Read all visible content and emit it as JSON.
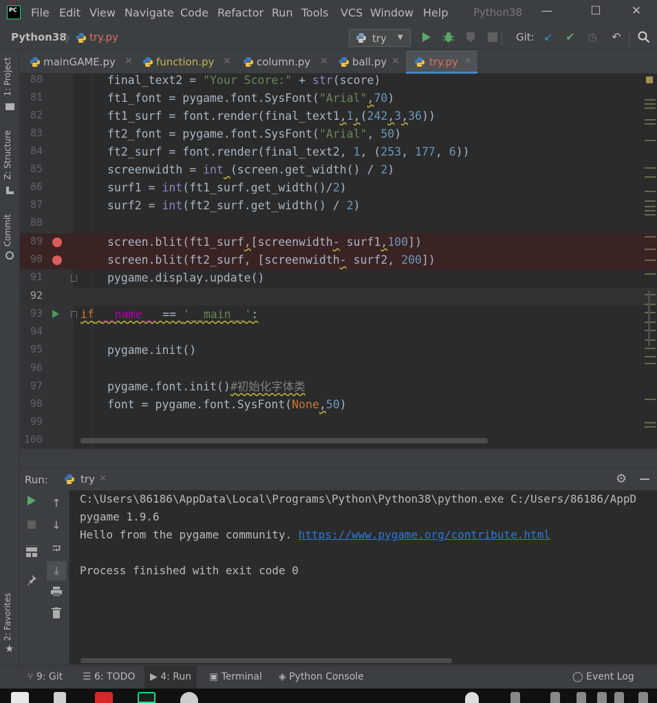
{
  "app": {
    "logo_text": "PC",
    "window_title": "Python38"
  },
  "menu": [
    "File",
    "Edit",
    "View",
    "Navigate",
    "Code",
    "Refactor",
    "Run",
    "Tools",
    "VCS",
    "Window",
    "Help"
  ],
  "window_controls": {
    "minimize": "—",
    "maximize": "☐",
    "close": "✕"
  },
  "navbar": {
    "project": "Python38",
    "separator": "〉",
    "file": "try.py",
    "run_config": "try",
    "git_label": "Git:"
  },
  "left_stripe": {
    "project": "1: Project",
    "structure": "Z: Structure",
    "commit": "Commit",
    "favorites": "2: Favorites"
  },
  "tabs": [
    {
      "label": "mainGAME.py",
      "active": false
    },
    {
      "label": "function.py",
      "active": false
    },
    {
      "label": "column.py",
      "active": false
    },
    {
      "label": "ball.py",
      "active": false
    },
    {
      "label": "try.py",
      "active": true
    }
  ],
  "editor": {
    "line_numbers": [
      "80",
      "81",
      "82",
      "83",
      "84",
      "85",
      "86",
      "87",
      "88",
      "89",
      "90",
      "91",
      "92",
      "93",
      "94",
      "95",
      "96",
      "97",
      "98",
      "99",
      "100"
    ],
    "breakpoint_lines": [
      "89",
      "90"
    ],
    "run_marker_line": "93"
  },
  "run": {
    "label": "Run:",
    "tab": "try",
    "output": {
      "cmd": "C:\\Users\\86186\\AppData\\Local\\Programs\\Python\\Python38\\python.exe C:/Users/86186/AppD",
      "version": "pygame 1.9.6",
      "hello": "Hello from the pygame community. ",
      "link": "https://www.pygame.org/contribute.html",
      "finished": "Process finished with exit code 0"
    }
  },
  "bottom_tabs": {
    "git": "9: Git",
    "todo": "6: TODO",
    "run": "4: Run",
    "terminal": "Terminal",
    "console": "Python Console",
    "event_log": "Event Log"
  },
  "colors": {
    "accent": "#4a88c7",
    "breakpoint": "#db5c5c",
    "run_green": "#499c54",
    "link": "#287bde",
    "active_file": "#e06c60"
  }
}
